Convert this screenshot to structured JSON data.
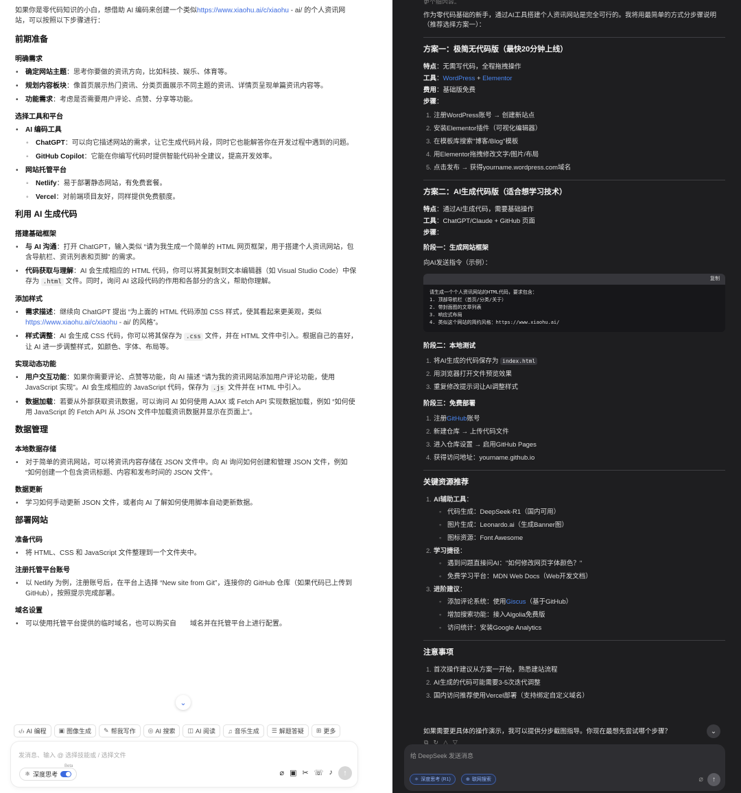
{
  "left": {
    "intro": {
      "before": "如果你是零代码知识的小白，想借助 AI 编码来创建一个类似",
      "link": "https://www.xiaohu.ai/c/xiaohu",
      "after": " - ai/ 的个人资讯网站，可以按照以下步骤进行："
    },
    "s1": {
      "title": "前期准备",
      "sub1": {
        "title": "明确需求",
        "items": [
          {
            "b": "确定网站主题",
            "t": "：思考你要做的资讯方向，比如科技、娱乐、体育等。"
          },
          {
            "b": "规划内容板块",
            "t": "：像首页展示热门资讯、分类页面展示不同主题的资讯、详情页呈现单篇资讯内容等。"
          },
          {
            "b": "功能需求",
            "t": "：考虑是否需要用户评论、点赞、分享等功能。"
          }
        ]
      },
      "sub2": {
        "title": "选择工具和平台",
        "g1": {
          "title": "AI 编码工具",
          "items": [
            {
              "b": "ChatGPT",
              "t": "：可以向它描述网站的需求，让它生成代码片段，同时它也能解答你在开发过程中遇到的问题。"
            },
            {
              "b": "GitHub Copilot",
              "t": "：它能在你编写代码时提供智能代码补全建议，提高开发效率。"
            }
          ]
        },
        "g2": {
          "title": "网站托管平台",
          "items": [
            {
              "b": "Netlify",
              "t": "：易于部署静态网站，有免费套餐。"
            },
            {
              "b": "Vercel",
              "t": "：对前端项目友好，同样提供免费额度。"
            }
          ]
        }
      }
    },
    "s2": {
      "title": "利用 AI 生成代码",
      "sub1": {
        "title": "搭建基础框架",
        "i1": {
          "b": "与 AI 沟通",
          "t": "：打开 ChatGPT，输入类似 “请为我生成一个简单的 HTML 网页框架，用于搭建个人资讯网站，包含导航栏、资讯列表和页脚” 的需求。"
        },
        "i2": {
          "b": "代码获取与理解",
          "t1": "：AI 会生成相应的 HTML 代码，你可以将其复制到文本编辑器（如 Visual Studio Code）中保存为 ",
          "code": ".html",
          "t2": " 文件。同时，询问 AI 这段代码的作用和各部分的含义，帮助你理解。"
        }
      },
      "sub2": {
        "title": "添加样式",
        "i1": {
          "b": "需求描述",
          "t1": "：继续向 ChatGPT 提出 “为上面的 HTML 代码添加 CSS 样式，使其看起来更美观，类似 ",
          "link": "https://www.xiaohu.ai/c/xiaohu",
          "t2": " - ai/ 的风格”。"
        },
        "i2": {
          "b": "样式调整",
          "t1": "：AI 会生成 CSS 代码，你可以将其保存为 ",
          "code": ".css",
          "t2": " 文件，并在 HTML 文件中引入。根据自己的喜好，让 AI 进一步调整样式，如颜色、字体、布局等。"
        }
      },
      "sub3": {
        "title": "实现动态功能",
        "i1": {
          "b": "用户交互功能",
          "t1": "：如果你需要评论、点赞等功能，向 AI 描述 “请为我的资讯网站添加用户评论功能，使用 JavaScript 实现”。AI 会生成相应的 JavaScript 代码，保存为 ",
          "code": ".js",
          "t2": " 文件并在 HTML 中引入。"
        },
        "i2": {
          "b": "数据加载",
          "t": "：若要从外部获取资讯数据，可以询问 AI 如何使用 AJAX 或 Fetch API 实现数据加载，例如 “如何使用 JavaScript 的 Fetch API 从 JSON 文件中加载资讯数据并显示在页面上”。"
        }
      }
    },
    "s3": {
      "title": "数据管理",
      "sub1": {
        "title": "本地数据存储",
        "t": "对于简单的资讯网站，可以将资讯内容存储在 JSON 文件中。向 AI 询问如何创建和管理 JSON 文件，例如 “如何创建一个包含资讯标题、内容和发布时间的 JSON 文件”。"
      },
      "sub2": {
        "title": "数据更新",
        "t": "学习如何手动更新 JSON 文件，或者向 AI 了解如何使用脚本自动更新数据。"
      }
    },
    "s4": {
      "title": "部署网站",
      "sub1": {
        "title": "准备代码",
        "t": "将 HTML、CSS 和 JavaScript 文件整理到一个文件夹中。"
      },
      "sub2": {
        "title": "注册托管平台账号",
        "t": "以 Netlify 为例，注册账号后，在平台上选择 “New site from Git”，连接你的 GitHub 仓库（如果代码已上传到 GitHub），按照提示完成部署。"
      },
      "sub3": {
        "title": "域名设置",
        "t": "可以使用托管平台提供的临时域名，也可以购买自　　域名并在托管平台上进行配置。"
      }
    },
    "chips": [
      {
        "icon": "‹/›",
        "label": "AI 编程"
      },
      {
        "icon": "▣",
        "label": "图像生成"
      },
      {
        "icon": "✎",
        "label": "帮我写作"
      },
      {
        "icon": "◎",
        "label": "AI 搜索"
      },
      {
        "icon": "◫",
        "label": "AI 阅读"
      },
      {
        "icon": "♫",
        "label": "音乐生成"
      },
      {
        "icon": "☰",
        "label": "解题答疑"
      },
      {
        "icon": "⊞",
        "label": "更多"
      }
    ],
    "composer": {
      "placeholder": "发消息、输入 @ 选择技能或 / 选择文件",
      "deep_label": "深度思考",
      "beta": "Beta"
    }
  },
  "right": {
    "faded_top": "更个细内容。",
    "intro": "作为零代码基础的新手，通过AI工具搭建个人资讯网站是完全可行的。我将用最简单的方式分步骤说明（推荐选择方案一）：",
    "plan1": {
      "title": "方案一：极简无代码版（最快20分钟上线）",
      "feature_label": "特点",
      "feature": "：无需写代码，全程拖拽操作",
      "tools_label": "工具",
      "tool_a": "WordPress",
      "tool_plus": " + ",
      "tool_b": "Elementor",
      "cost_label": "费用",
      "cost": "：基础版免费",
      "steps_label": "步骤",
      "steps": [
        "注册WordPress账号 → 创建新站点",
        "安装Elementor插件（可视化编辑器）",
        "在模板库搜索\"博客/Blog\"模板",
        "用Elementor拖拽修改文字/图片/布局",
        "点击发布 → 获得yourname.wordpress.com域名"
      ]
    },
    "plan2": {
      "title": "方案二：AI生成代码版（适合想学习技术）",
      "feature_label": "特点",
      "feature": "：通过AI生成代码，需要基础操作",
      "tools_label": "工具",
      "tools": "：ChatGPT/Claude + GitHub 页面",
      "steps_label": "步骤",
      "stage1": "阶段一：生成网站框架",
      "send_label": "向AI发送指令（示例）：",
      "copy_label": "复制",
      "code": "请生成一个个人资讯网站的HTML代码，要求包含：\n1. 顶部导航栏（首页/分类/关于）\n2. 带封面图的文章列表\n3. 响应式布局\n4. 类似这个网站的简约风格：https://www.xiaohu.ai/",
      "stage2": "阶段二：本地测试",
      "s2_1a": "将AI生成的代码保存为 ",
      "s2_1code": "index.html",
      "s2_2": "用浏览器打开文件预览效果",
      "s2_3": "重复修改提示词让AI调整样式",
      "stage3": "阶段三：免费部署",
      "s3_1a": "注册",
      "s3_1link": "GitHub",
      "s3_1b": "账号",
      "s3_2": "新建仓库 → 上传代码文件",
      "s3_3": "进入仓库设置 → 启用GitHub Pages",
      "s3_4": "获得访问地址：yourname.github.io"
    },
    "resources": {
      "title": "关键资源推荐",
      "g1": {
        "title": "AI辅助工具",
        "items": [
          "代码生成：DeepSeek-R1（国内可用）",
          "图片生成：Leonardo.ai（生成Banner图）",
          "图标资源：Font Awesome"
        ]
      },
      "g2": {
        "title": "学习捷径",
        "items": [
          "遇到问题直接问AI：\"如何修改网页字体颜色？\"",
          "免费学习平台：MDN Web Docs（Web开发文档）"
        ]
      },
      "g3": {
        "title": "进阶建议",
        "i1a": "添加评论系统：使用",
        "i1link": "Giscus",
        "i1b": "（基于GitHub）",
        "i2": "增加搜索功能：接入Algolia免费版",
        "i3": "访问统计：安装Google Analytics"
      }
    },
    "notes": {
      "title": "注意事项",
      "items": [
        "首次操作建议从方案一开始，熟悉建站流程",
        "AI生成的代码可能需要3-5次迭代调整",
        "国内访问推荐使用Vercel部署（支持绑定自定义域名）"
      ]
    },
    "closing": "如果需要更具体的操作演示，我可以提供分步截图指导。你现在最想先尝试哪个步骤？",
    "composer": {
      "placeholder": "给 DeepSeek 发送消息",
      "deep_label": "深度思考 (R1)",
      "search_label": "联网搜索"
    }
  }
}
